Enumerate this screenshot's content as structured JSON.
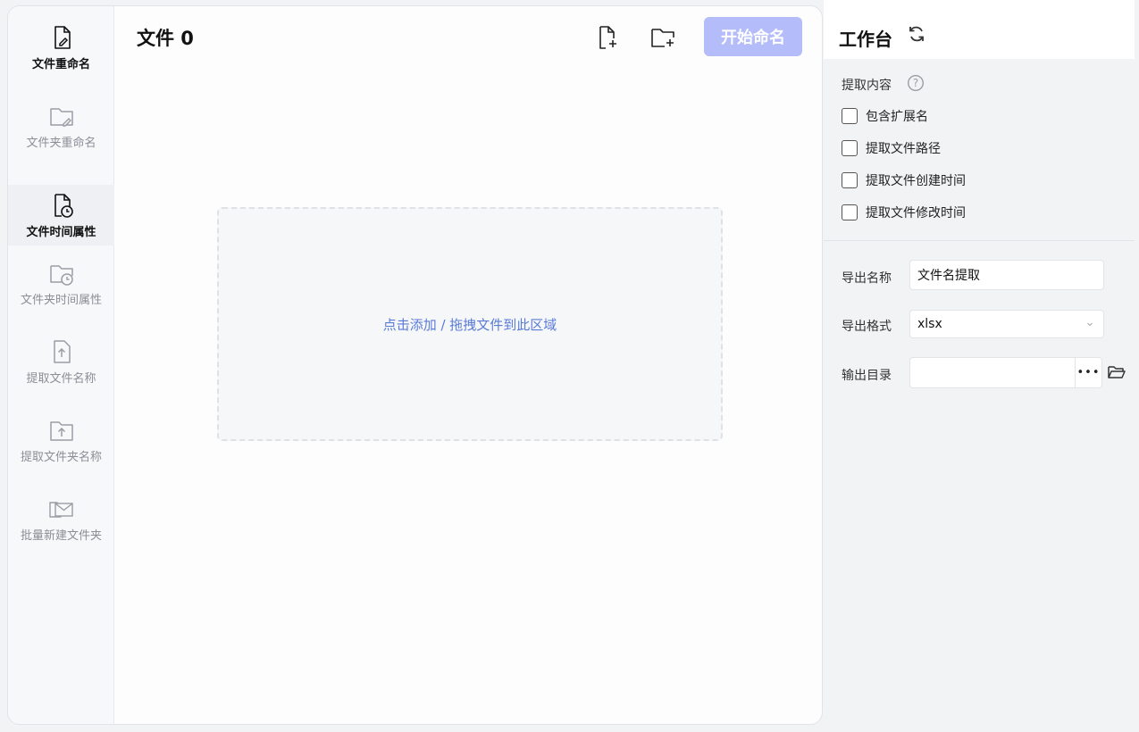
{
  "sidebar": {
    "items": [
      {
        "label": "文件重命名",
        "icon": "file-edit-icon",
        "state": "active"
      },
      {
        "label": "文件夹重命名",
        "icon": "folder-edit-icon",
        "state": "normal"
      },
      {
        "label": "文件时间属性",
        "icon": "file-clock-icon",
        "state": "selected"
      },
      {
        "label": "文件夹时间属性",
        "icon": "folder-clock-icon",
        "state": "normal"
      },
      {
        "label": "提取文件名称",
        "icon": "file-upload-icon",
        "state": "normal"
      },
      {
        "label": "提取文件夹名称",
        "icon": "folder-upload-icon",
        "state": "normal"
      },
      {
        "label": "批量新建文件夹",
        "icon": "folder-mail-icon",
        "state": "normal"
      }
    ]
  },
  "main": {
    "title": "文件 0",
    "add_file_icon": "file-plus-icon",
    "add_folder_icon": "folder-plus-icon",
    "start_label": "开始命名",
    "start_color": "#b4bcf9",
    "dropzone_text": "点击添加 / 拖拽文件到此区域",
    "dropzone_text_color": "#5a7bd8"
  },
  "panel": {
    "title": "工作台",
    "section_label": "提取内容",
    "options": [
      {
        "label": "包含扩展名",
        "checked": false
      },
      {
        "label": "提取文件路径",
        "checked": false
      },
      {
        "label": "提取文件创建时间",
        "checked": false
      },
      {
        "label": "提取文件修改时间",
        "checked": false
      }
    ],
    "export_name_label": "导出名称",
    "export_name_value": "文件名提取",
    "export_format_label": "导出格式",
    "export_format_value": "xlsx",
    "output_dir_label": "输出目录",
    "output_dir_value": "",
    "more_label": "•••"
  }
}
